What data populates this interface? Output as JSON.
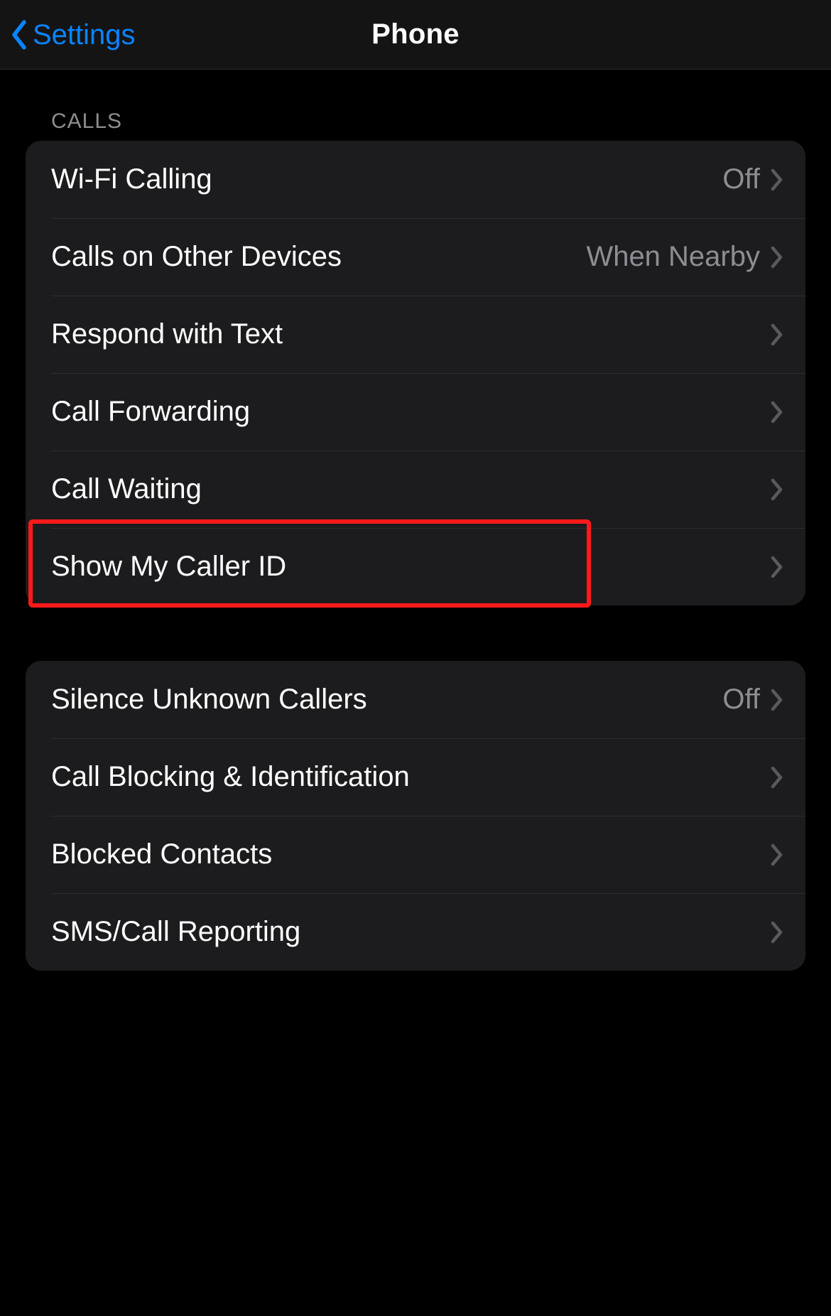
{
  "navbar": {
    "back_label": "Settings",
    "title": "Phone"
  },
  "sections": {
    "calls_header": "CALLS",
    "group1": {
      "items": [
        {
          "label": "Wi-Fi Calling",
          "value": "Off"
        },
        {
          "label": "Calls on Other Devices",
          "value": "When Nearby"
        },
        {
          "label": "Respond with Text",
          "value": ""
        },
        {
          "label": "Call Forwarding",
          "value": ""
        },
        {
          "label": "Call Waiting",
          "value": ""
        },
        {
          "label": "Show My Caller ID",
          "value": ""
        }
      ]
    },
    "group2": {
      "items": [
        {
          "label": "Silence Unknown Callers",
          "value": "Off"
        },
        {
          "label": "Call Blocking & Identification",
          "value": ""
        },
        {
          "label": "Blocked Contacts",
          "value": ""
        },
        {
          "label": "SMS/Call Reporting",
          "value": ""
        }
      ]
    }
  },
  "highlight": {
    "target_label": "Show My Caller ID"
  }
}
